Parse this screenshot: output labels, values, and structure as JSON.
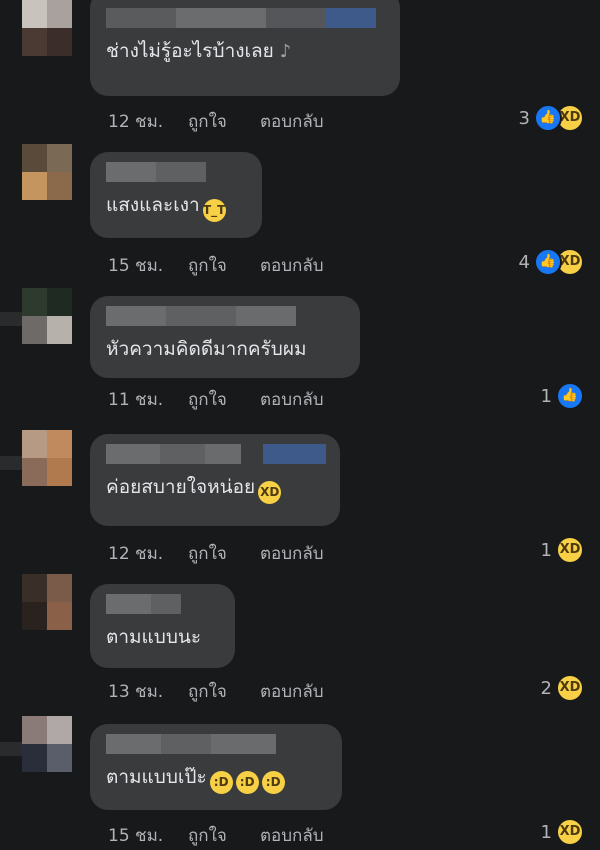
{
  "comments": [
    {
      "text": "ช่างไม่รู้อะไรบ้างเลย",
      "time": "12 ชม.",
      "like_label": "ถูกใจ",
      "reply_label": "ตอบกลับ",
      "reaction_count": "3",
      "reactions": [
        "like-icon",
        "haha-icon"
      ]
    },
    {
      "text": "แสงและเงา",
      "time": "15 ชม.",
      "like_label": "ถูกใจ",
      "reply_label": "ตอบกลับ",
      "reaction_count": "4",
      "reactions": [
        "like-icon",
        "haha-icon"
      ]
    },
    {
      "text": "หัวความคิดดีมากครับผม",
      "time": "11 ชม.",
      "like_label": "ถูกใจ",
      "reply_label": "ตอบกลับ",
      "reaction_count": "1",
      "reactions": [
        "like-icon"
      ]
    },
    {
      "text": "ค่อยสบายใจหน่อย",
      "time": "12 ชม.",
      "like_label": "ถูกใจ",
      "reply_label": "ตอบกลับ",
      "reaction_count": "1",
      "reactions": [
        "haha-icon"
      ]
    },
    {
      "text": "ตามแบบนะ",
      "time": "13 ชม.",
      "like_label": "ถูกใจ",
      "reply_label": "ตอบกลับ",
      "reaction_count": "2",
      "reactions": [
        "haha-icon"
      ]
    },
    {
      "text": "ตามแบบเป๊ะ",
      "time": "15 ชม.",
      "like_label": "ถูกใจ",
      "reply_label": "ตอบกลับ",
      "reaction_count": "1",
      "reactions": [
        "haha-icon"
      ]
    }
  ],
  "colors": {
    "background": "#18191a",
    "bubble": "#3a3b3c",
    "like_blue": "#1877f2",
    "haha_yellow": "#f7d046",
    "meta_text": "#b0b3b8"
  }
}
